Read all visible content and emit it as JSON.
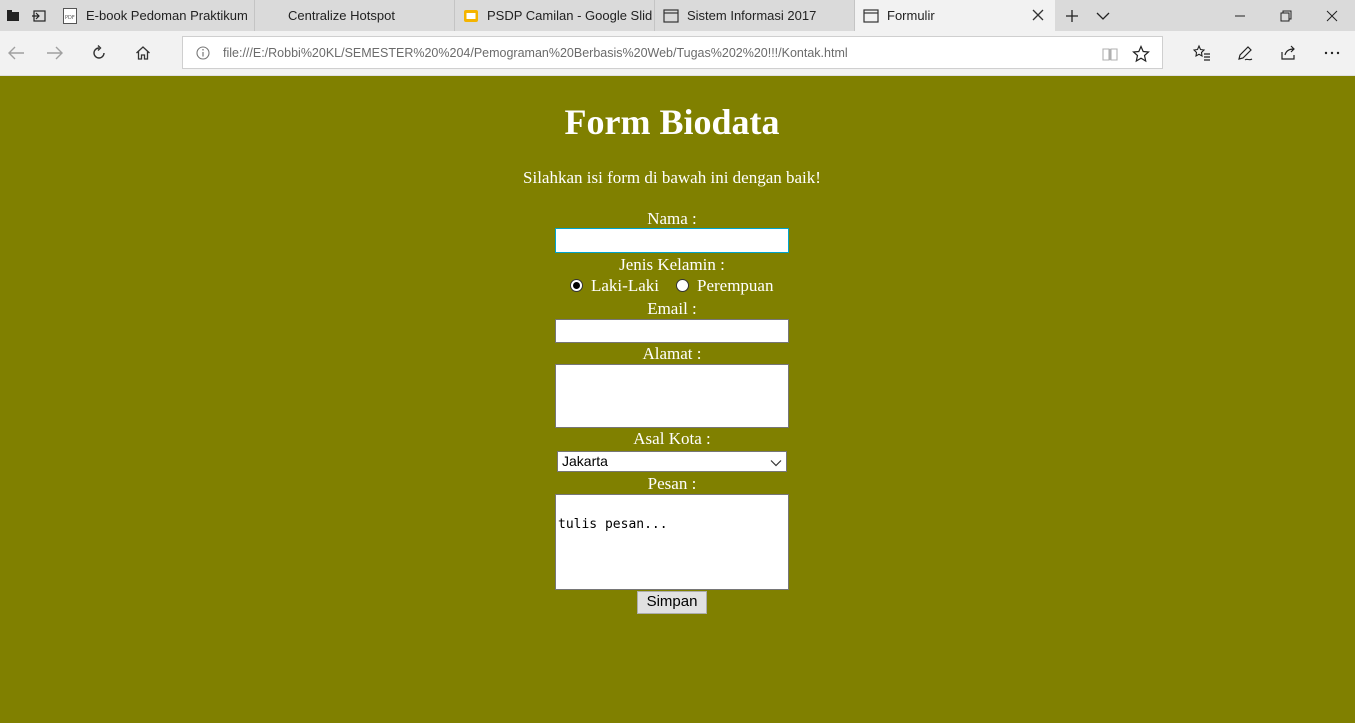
{
  "browser": {
    "tabs": [
      {
        "title": "E-book Pedoman Praktikum",
        "icon": "pdf-icon"
      },
      {
        "title": "Centralize Hotspot",
        "icon": "none"
      },
      {
        "title": "PSDP Camilan - Google Slid",
        "icon": "google-slides-icon"
      },
      {
        "title": "Sistem Informasi 2017",
        "icon": "page-icon"
      },
      {
        "title": "Formulir",
        "icon": "page-icon",
        "active": true
      }
    ],
    "url": "file:///E:/Robbi%20KL/SEMESTER%20%204/Pemograman%20Berbasis%20Web/Tugas%202%20!!!/Kontak.html"
  },
  "form": {
    "title": "Form Biodata",
    "intro": "Silahkan isi form di bawah ini dengan baik!",
    "nama_label": "Nama :",
    "nama_value": "",
    "gender_label": "Jenis Kelamin :",
    "gender_options": [
      "Laki-Laki",
      "Perempuan"
    ],
    "gender_selected": "Laki-Laki",
    "email_label": "Email :",
    "email_value": "",
    "alamat_label": "Alamat :",
    "alamat_value": "",
    "kota_label": "Asal Kota :",
    "kota_selected": "Jakarta",
    "pesan_label": "Pesan :",
    "pesan_value": "tulis pesan...",
    "submit_label": "Simpan"
  },
  "colors": {
    "page_bg": "#808000",
    "text": "#ffffff",
    "focus_border": "#00a3cc"
  }
}
